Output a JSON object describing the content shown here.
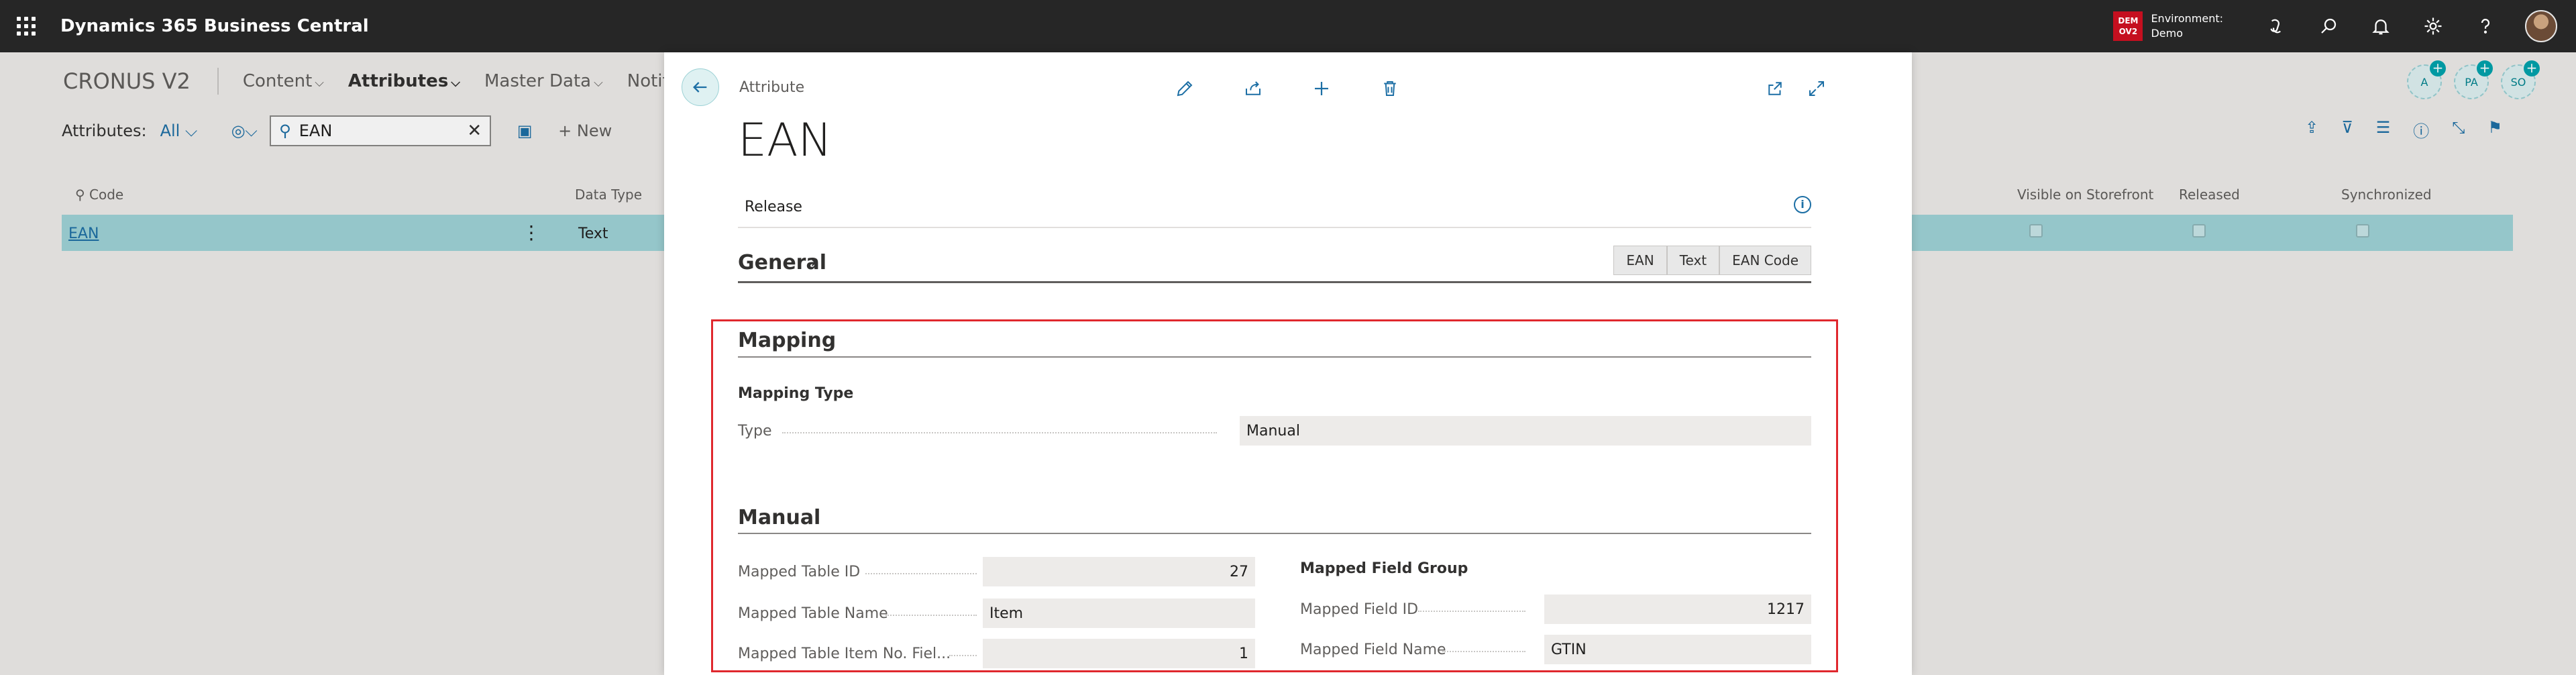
{
  "appbar": {
    "title": "Dynamics 365 Business Central",
    "env_badge": [
      "DEM",
      "OV2"
    ],
    "env_label": "Environment:",
    "env_value": "Demo",
    "icons": [
      "copilot-icon",
      "search-icon",
      "bell-icon",
      "gear-icon",
      "help-icon"
    ]
  },
  "page": {
    "company": "CRONUS V2",
    "nav": [
      {
        "label": "Content",
        "bold": false
      },
      {
        "label": "Attributes",
        "bold": true
      },
      {
        "label": "Master Data",
        "bold": false
      },
      {
        "label": "Notific",
        "bold": false
      }
    ],
    "roles": [
      "A",
      "PA",
      "SO"
    ],
    "action_bar": {
      "label": "Attributes:",
      "filter": "All",
      "search_value": "EAN",
      "new_label": "New"
    },
    "columns": {
      "code": "Code",
      "data_type": "Data Type",
      "visible": "Visible on Storefront",
      "released": "Released",
      "synchronized": "Synchronized"
    },
    "rows": [
      {
        "code": "EAN",
        "data_type": "Text"
      }
    ]
  },
  "card": {
    "breadcrumb": "Attribute",
    "title": "EAN",
    "release_label": "Release",
    "general": {
      "heading": "General",
      "chips": [
        "EAN",
        "Text",
        "EAN Code"
      ]
    },
    "mapping": {
      "heading": "Mapping",
      "subheading": "Mapping Type",
      "type_label": "Type",
      "type_value": "Manual"
    },
    "manual": {
      "heading": "Manual",
      "left": [
        {
          "label": "Mapped Table ID",
          "value": "27",
          "numeric": true
        },
        {
          "label": "Mapped Table Name",
          "value": "Item",
          "numeric": false
        },
        {
          "label": "Mapped Table Item No. Fiel...",
          "value": "1",
          "numeric": true
        }
      ],
      "group_heading": "Mapped Field Group",
      "right": [
        {
          "label": "Mapped Field ID",
          "value": "1217",
          "numeric": true
        },
        {
          "label": "Mapped Field Name",
          "value": "GTIN",
          "numeric": false
        }
      ]
    }
  }
}
